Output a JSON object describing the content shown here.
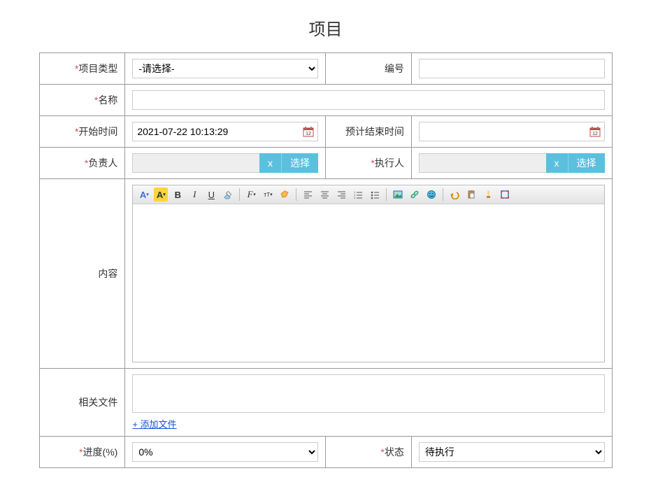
{
  "pageTitle": "项目",
  "labels": {
    "projectType": "项目类型",
    "serialNo": "编号",
    "name": "名称",
    "startTime": "开始时间",
    "endTime": "预计结束时间",
    "owner": "负责人",
    "executor": "执行人",
    "content": "内容",
    "files": "相关文件",
    "progress": "进度(%)",
    "status": "状态"
  },
  "values": {
    "projectTypePlaceholder": "-请选择-",
    "serialNo": "",
    "name": "",
    "startTime": "2021-07-22 10:13:29",
    "endTime": "",
    "owner": "",
    "executor": "",
    "progress": "0%",
    "status": "待执行"
  },
  "buttons": {
    "clear": "x",
    "pick": "选择",
    "addFile": "+ 添加文件"
  },
  "options": {
    "progress": [
      "0%"
    ],
    "status": [
      "待执行"
    ]
  }
}
